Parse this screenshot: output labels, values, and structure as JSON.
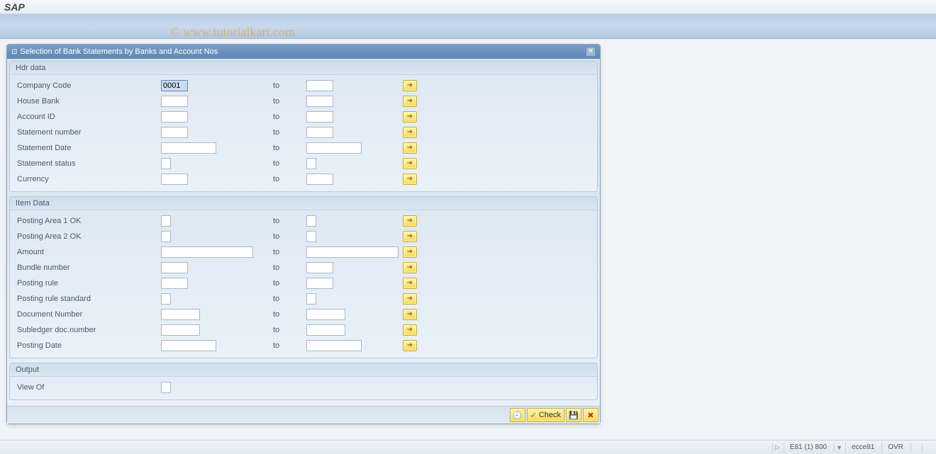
{
  "app": {
    "title": "SAP"
  },
  "watermark": "© www.tutorialkart.com",
  "modal": {
    "title": "Selection of Bank Statements by Banks and Account Nos",
    "groups": {
      "hdr": {
        "title": "Hdr data",
        "rows": [
          {
            "label": "Company Code",
            "from": "0001",
            "to": "",
            "size": "short",
            "selected": true
          },
          {
            "label": "House Bank",
            "from": "",
            "to": "",
            "size": "short"
          },
          {
            "label": "Account ID",
            "from": "",
            "to": "",
            "size": "short"
          },
          {
            "label": "Statement number",
            "from": "",
            "to": "",
            "size": "short"
          },
          {
            "label": "Statement Date",
            "from": "",
            "to": "",
            "size": "date"
          },
          {
            "label": "Statement status",
            "from": "",
            "to": "",
            "size": "mini"
          },
          {
            "label": "Currency",
            "from": "",
            "to": "",
            "size": "short"
          }
        ]
      },
      "item": {
        "title": "Item Data",
        "rows": [
          {
            "label": "Posting Area 1 OK",
            "from": "",
            "to": "",
            "size": "mini"
          },
          {
            "label": "Posting Area 2 OK",
            "from": "",
            "to": "",
            "size": "mini"
          },
          {
            "label": "Amount",
            "from": "",
            "to": "",
            "size": "amount"
          },
          {
            "label": "Bundle number",
            "from": "",
            "to": "",
            "size": "short"
          },
          {
            "label": "Posting rule",
            "from": "",
            "to": "",
            "size": "short"
          },
          {
            "label": "Posting rule standard",
            "from": "",
            "to": "",
            "size": "mini"
          },
          {
            "label": "Document Number",
            "from": "",
            "to": "",
            "size": "med"
          },
          {
            "label": "Subledger doc.number",
            "from": "",
            "to": "",
            "size": "med"
          },
          {
            "label": "Posting Date",
            "from": "",
            "to": "",
            "size": "date"
          }
        ]
      },
      "output": {
        "title": "Output",
        "rows": [
          {
            "label": "View Of",
            "from": "",
            "size": "mini",
            "noRange": true
          }
        ]
      }
    },
    "to_label": "to",
    "footer": {
      "execute": "",
      "check": "Check"
    }
  },
  "status": {
    "system": "E81 (1) 800",
    "server": "ecce81",
    "mode": "OVR"
  }
}
